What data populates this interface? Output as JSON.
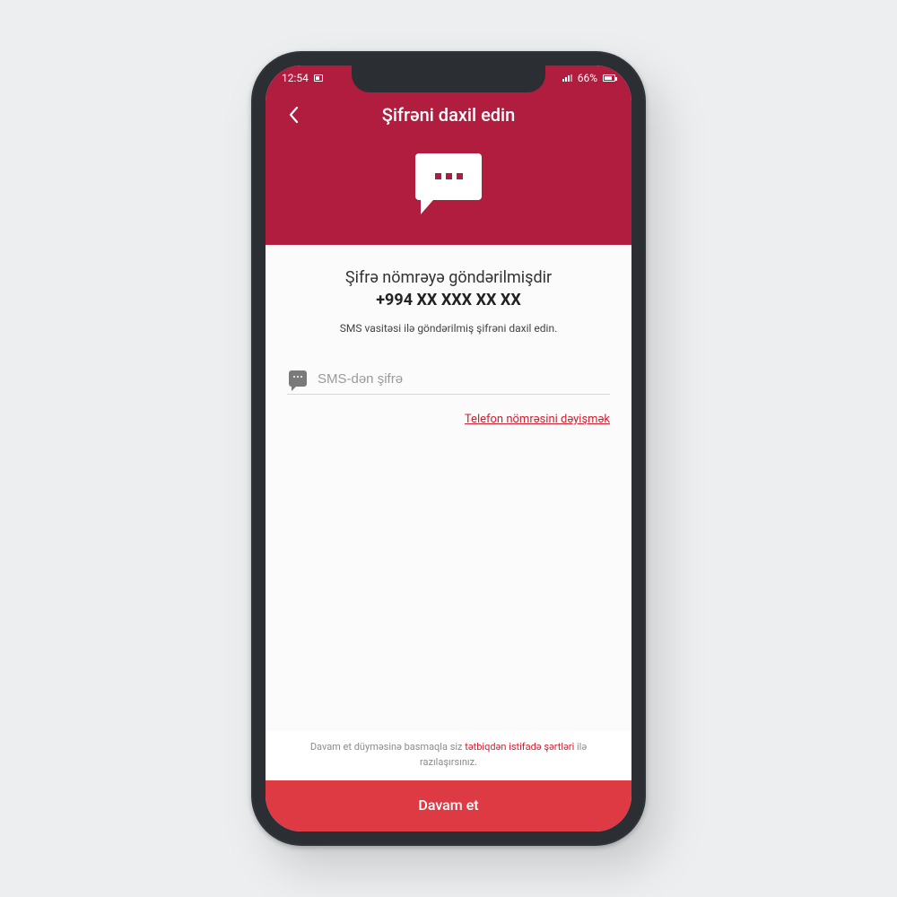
{
  "status_bar": {
    "time": "12:54",
    "battery_text": "66%"
  },
  "header": {
    "title": "Şifrəni daxil edin"
  },
  "content": {
    "sent_message": "Şifrə nömrəyə göndərilmişdir",
    "phone_number": "+994 XX XXX XX XX",
    "subtitle": "SMS vasitəsi ilə göndərilmiş şifrəni daxil edin.",
    "input_placeholder": "SMS-dən şifrə",
    "change_phone_link": "Telefon nömrəsini dəyişmək"
  },
  "footer": {
    "agree_prefix": "Davam et düyməsinə basmaqla siz ",
    "agree_link": "tətbiqdən istifadə şərtləri",
    "agree_suffix": " ilə razılaşırsınız.",
    "continue_label": "Davam et"
  },
  "colors": {
    "brand": "#b01d3e",
    "accent": "#de3a44",
    "link": "#d02030"
  }
}
